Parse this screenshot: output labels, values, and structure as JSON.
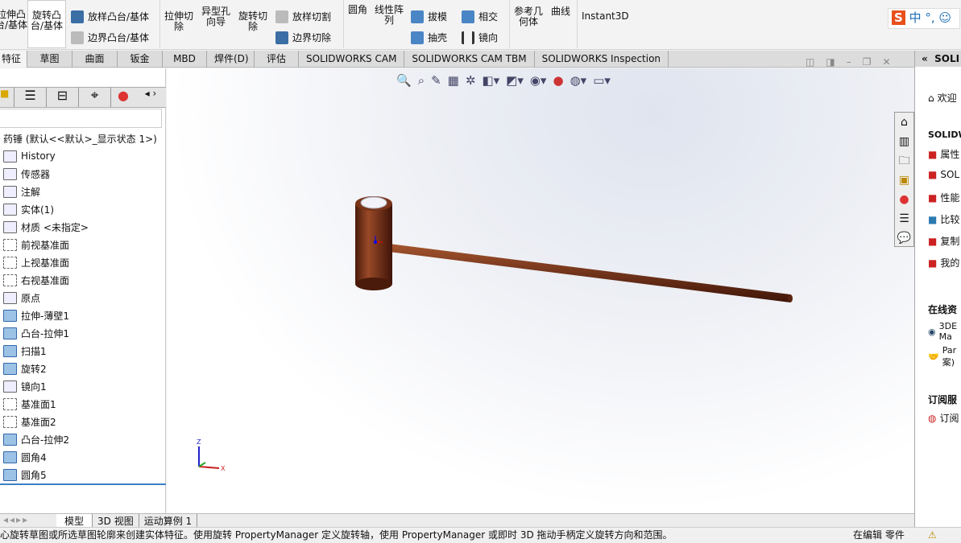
{
  "ribbon": {
    "extrude_boss": "拉伸凸\n台/基体",
    "revolve_boss": "旋转凸\n台/基体",
    "loft_boss": "放样凸台/基体",
    "boundary_boss": "边界凸台/基体",
    "extrude_cut": "拉伸切\n除",
    "hole_wizard": "异型孔\n向导",
    "revolve_cut": "旋转切\n除",
    "loft_cut": "放样切割",
    "boundary_cut": "边界切除",
    "fillet": "圆角",
    "linear_pattern": "线性阵\n列",
    "draft": "拔模",
    "shell": "抽壳",
    "intersect": "相交",
    "mirror": "镜向",
    "ref_geometry": "参考几\n何体",
    "curves": "曲线",
    "instant3d": "Instant3D"
  },
  "tabs": [
    "特征",
    "草图",
    "曲面",
    "钣金",
    "MBD",
    "焊件(D)",
    "评估",
    "SOLIDWORKS CAM",
    "SOLIDWORKS CAM TBM",
    "SOLIDWORKS Inspection"
  ],
  "tree": {
    "root": "药锤  (默认<<默认>_显示状态 1>)",
    "items": [
      "History",
      "传感器",
      "注解",
      "实体(1)",
      "材质 <未指定>",
      "前视基准面",
      "上视基准面",
      "右视基准面",
      "原点",
      "拉伸-薄壁1",
      "凸台-拉伸1",
      "扫描1",
      "旋转2",
      "镜向1",
      "基准面1",
      "基准面2",
      "凸台-拉伸2",
      "圆角4",
      "圆角5"
    ]
  },
  "right_pane": {
    "title": "SOLI",
    "welcome": "欢迎",
    "section1": "SOLIDW",
    "items1": [
      "属性",
      "SOL",
      "性能",
      "比较",
      "复制",
      "我的"
    ],
    "section2": "在线资",
    "items2": [
      "3DE Ma",
      "Par 案)"
    ],
    "section3": "订阅服",
    "items3": [
      "订阅"
    ]
  },
  "bottom_tabs": [
    "模型",
    "3D 视图",
    "运动算例 1"
  ],
  "status": {
    "message": "心旋转草图或所选草图轮廓来创建实体特征。使用旋转 PropertyManager 定义旋转轴，使用 PropertyManager 或即时 3D 拖动手柄定义旋转方向和范围。",
    "mode": "在编辑 零件"
  },
  "colors": {
    "part": "#6b2a14",
    "accent": "#1f6fb5"
  }
}
